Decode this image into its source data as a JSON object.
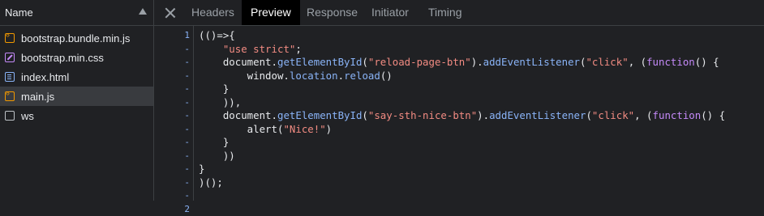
{
  "file_panel": {
    "header": "Name",
    "files": [
      {
        "name": "bootstrap.bundle.min.js",
        "type": "js",
        "selected": false
      },
      {
        "name": "bootstrap.min.css",
        "type": "css",
        "selected": false
      },
      {
        "name": "index.html",
        "type": "html",
        "selected": false
      },
      {
        "name": "main.js",
        "type": "js",
        "selected": true
      },
      {
        "name": "ws",
        "type": "ws",
        "selected": false
      }
    ]
  },
  "tabs": {
    "close_icon": "close-icon",
    "items": [
      "Headers",
      "Preview",
      "Response",
      "Initiator",
      "Timing"
    ],
    "active": "Preview"
  },
  "editor": {
    "line_numbers": [
      "1",
      "-",
      "-",
      "-",
      "-",
      "-",
      "-",
      "-",
      "-",
      "-",
      "-",
      "-",
      "-",
      "2"
    ],
    "lines": [
      [
        {
          "t": "(()=>{",
          "c": "plain"
        }
      ],
      [
        {
          "t": "    ",
          "c": "plain"
        },
        {
          "t": "\"use strict\"",
          "c": "str"
        },
        {
          "t": ";",
          "c": "plain"
        }
      ],
      [
        {
          "t": "    document.",
          "c": "plain"
        },
        {
          "t": "getElementById",
          "c": "fn"
        },
        {
          "t": "(",
          "c": "plain"
        },
        {
          "t": "\"reload-page-btn\"",
          "c": "str"
        },
        {
          "t": ").",
          "c": "plain"
        },
        {
          "t": "addEventListener",
          "c": "fn"
        },
        {
          "t": "(",
          "c": "plain"
        },
        {
          "t": "\"click\"",
          "c": "str"
        },
        {
          "t": ", (",
          "c": "plain"
        },
        {
          "t": "function",
          "c": "kw"
        },
        {
          "t": "() {",
          "c": "plain"
        }
      ],
      [
        {
          "t": "        window.",
          "c": "plain"
        },
        {
          "t": "location",
          "c": "fn"
        },
        {
          "t": ".",
          "c": "plain"
        },
        {
          "t": "reload",
          "c": "fn"
        },
        {
          "t": "()",
          "c": "plain"
        }
      ],
      [
        {
          "t": "    }",
          "c": "plain"
        }
      ],
      [
        {
          "t": "    )),",
          "c": "plain"
        }
      ],
      [
        {
          "t": "    document.",
          "c": "plain"
        },
        {
          "t": "getElementById",
          "c": "fn"
        },
        {
          "t": "(",
          "c": "plain"
        },
        {
          "t": "\"say-sth-nice-btn\"",
          "c": "str"
        },
        {
          "t": ").",
          "c": "plain"
        },
        {
          "t": "addEventListener",
          "c": "fn"
        },
        {
          "t": "(",
          "c": "plain"
        },
        {
          "t": "\"click\"",
          "c": "str"
        },
        {
          "t": ", (",
          "c": "plain"
        },
        {
          "t": "function",
          "c": "kw"
        },
        {
          "t": "() {",
          "c": "plain"
        }
      ],
      [
        {
          "t": "        alert(",
          "c": "plain"
        },
        {
          "t": "\"Nice!\"",
          "c": "str"
        },
        {
          "t": ")",
          "c": "plain"
        }
      ],
      [
        {
          "t": "    }",
          "c": "plain"
        }
      ],
      [
        {
          "t": "    ))",
          "c": "plain"
        }
      ],
      [
        {
          "t": "}",
          "c": "plain"
        }
      ],
      [
        {
          "t": ")();",
          "c": "plain"
        }
      ],
      [
        {
          "t": "",
          "c": "plain"
        }
      ]
    ]
  },
  "colors": {
    "background": "#202124",
    "string": "#f28b82",
    "function": "#8ab4f8",
    "keyword": "#c58af9",
    "active_tab_bg": "#000000",
    "selected_row_bg": "#393b3f"
  }
}
